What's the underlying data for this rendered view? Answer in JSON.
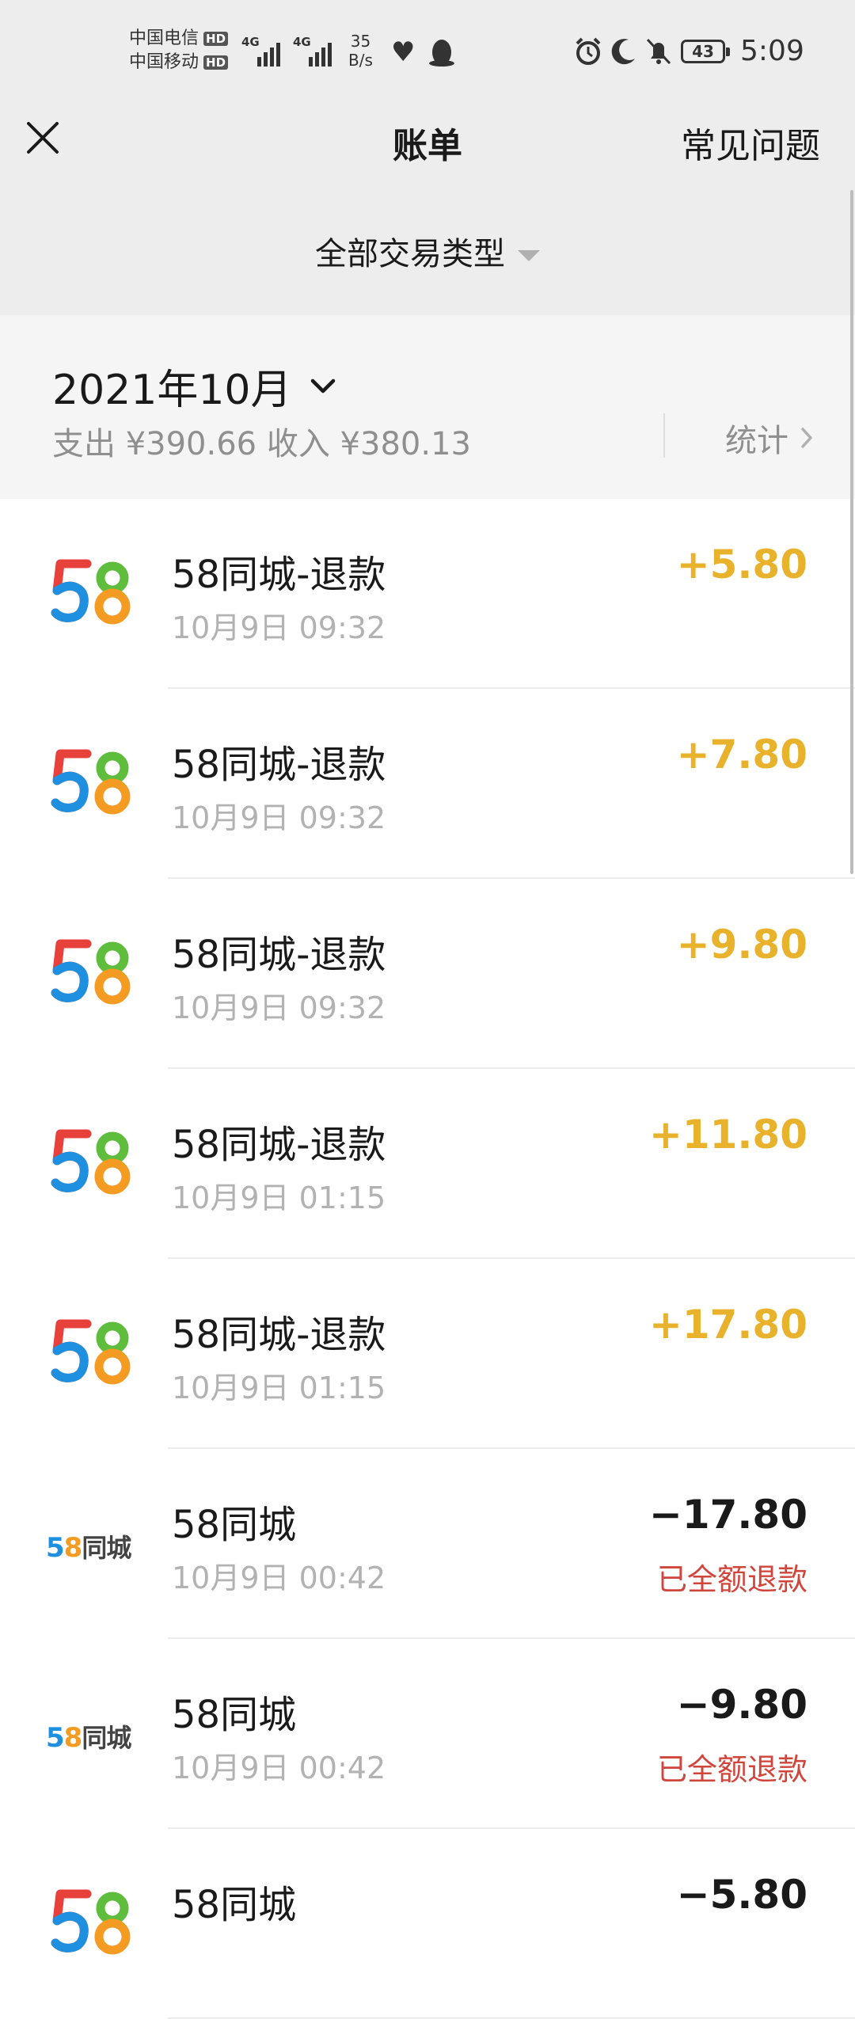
{
  "status_bar": {
    "carrier1": "中国电信",
    "carrier2": "中国移动",
    "hd_badge": "HD",
    "signal_label": "4G",
    "speed_value": "35",
    "speed_unit": "B/s",
    "battery": "43",
    "time": "5:09"
  },
  "header": {
    "title": "账单",
    "faq": "常见问题"
  },
  "filter": {
    "label": "全部交易类型"
  },
  "month": {
    "label": "2021年10月",
    "summary": "支出 ¥390.66 收入 ¥380.13",
    "stats": "统计"
  },
  "transactions": [
    {
      "logo": "58",
      "title": "58同城-退款",
      "time": "10月9日 09:32",
      "amount": "+5.80",
      "status": ""
    },
    {
      "logo": "58",
      "title": "58同城-退款",
      "time": "10月9日 09:32",
      "amount": "+7.80",
      "status": ""
    },
    {
      "logo": "58",
      "title": "58同城-退款",
      "time": "10月9日 09:32",
      "amount": "+9.80",
      "status": ""
    },
    {
      "logo": "58",
      "title": "58同城-退款",
      "time": "10月9日 01:15",
      "amount": "+11.80",
      "status": ""
    },
    {
      "logo": "58",
      "title": "58同城-退款",
      "time": "10月9日 01:15",
      "amount": "+17.80",
      "status": ""
    },
    {
      "logo": "58同城",
      "title": "58同城",
      "time": "10月9日 00:42",
      "amount": "−17.80",
      "status": "已全额退款"
    },
    {
      "logo": "58同城",
      "title": "58同城",
      "time": "10月9日 00:42",
      "amount": "−9.80",
      "status": "已全额退款"
    },
    {
      "logo": "58",
      "title": "58同城",
      "time": "",
      "amount": "−5.80",
      "status": ""
    }
  ],
  "colors": {
    "income": "#e9b22d",
    "expense": "#1a1a1a",
    "refund_status": "#d0453c",
    "logo_blue": "#1f8fe0",
    "logo_red": "#e8413b",
    "logo_green": "#5ebd3c",
    "logo_orange": "#f39b22"
  }
}
